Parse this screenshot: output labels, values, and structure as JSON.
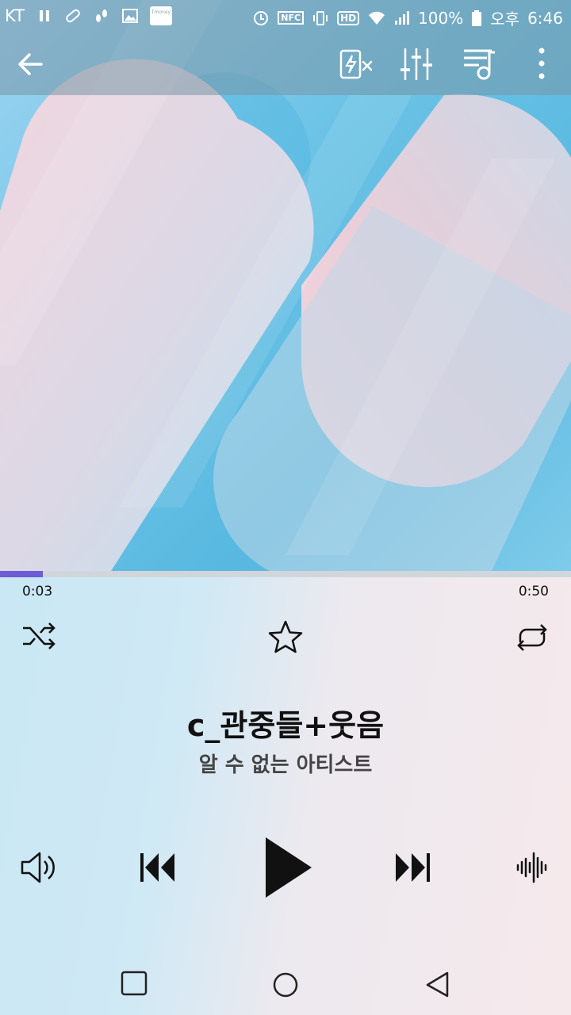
{
  "status_bar": {
    "carrier": "KT",
    "notification_app_label": "Tmoney",
    "battery_percent": "100%",
    "period": "오후",
    "time": "6:46"
  },
  "toolbar": {
    "icons": [
      "back-arrow-icon",
      "flash-off-icon",
      "equalizer-icon",
      "playlist-icon",
      "more-vert-icon"
    ]
  },
  "player": {
    "progress_fraction": 0.075,
    "elapsed": "0:03",
    "duration": "0:50",
    "title": "c_관중들+웃음",
    "artist": "알 수 없는 아티스트",
    "accent_color": "#6e5bd6"
  }
}
